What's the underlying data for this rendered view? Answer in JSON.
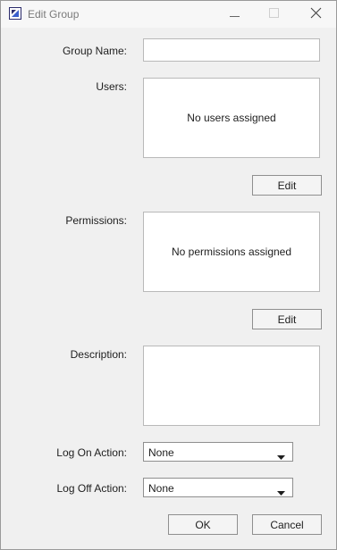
{
  "window": {
    "title": "Edit Group",
    "controls": {
      "minimize_icon": "minimize-icon",
      "maximize_icon": "maximize-icon",
      "close_icon": "close-icon"
    }
  },
  "form": {
    "group_name": {
      "label": "Group Name:",
      "value": ""
    },
    "users": {
      "label": "Users:",
      "empty_text": "No users assigned",
      "edit_label": "Edit"
    },
    "permissions": {
      "label": "Permissions:",
      "empty_text": "No permissions assigned",
      "edit_label": "Edit"
    },
    "description": {
      "label": "Description:",
      "value": ""
    },
    "log_on_action": {
      "label": "Log On Action:",
      "selected": "None"
    },
    "log_off_action": {
      "label": "Log Off Action:",
      "selected": "None"
    }
  },
  "footer": {
    "ok_label": "OK",
    "cancel_label": "Cancel"
  },
  "colors": {
    "accent": "#3a5fcd",
    "icon_dark": "#2b2b6b",
    "border": "#b9b9b9",
    "background": "#f0f0f0"
  }
}
